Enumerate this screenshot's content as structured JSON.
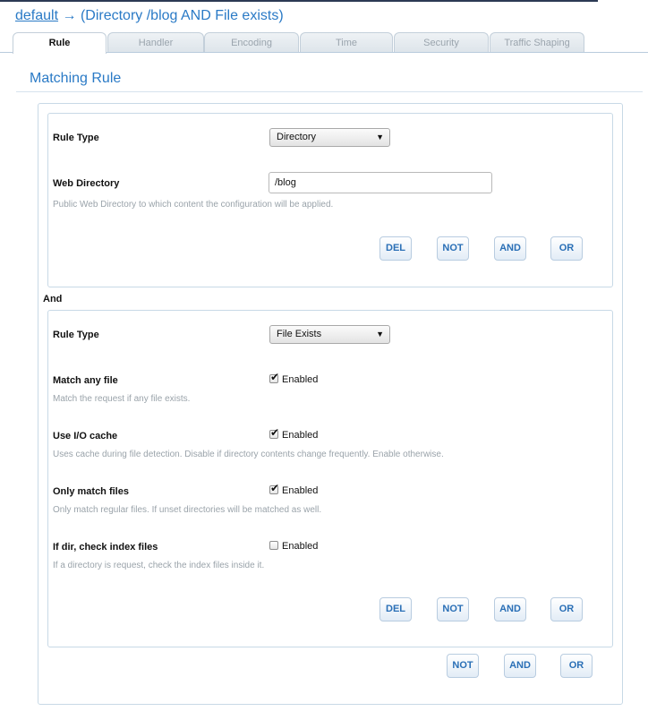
{
  "header": {
    "root_link": "default",
    "crumb_rest": " → (Directory /blog AND File exists)"
  },
  "tabs": [
    {
      "label": "Rule",
      "active": true
    },
    {
      "label": "Handler"
    },
    {
      "label": "Encoding"
    },
    {
      "label": "Time"
    },
    {
      "label": "Security"
    },
    {
      "label": "Traffic Shaping"
    }
  ],
  "section": {
    "title": "Matching Rule"
  },
  "rule1": {
    "type_label": "Rule Type",
    "type_value": "Directory",
    "dir_label": "Web Directory",
    "dir_value": "/blog",
    "dir_hint": "Public Web Directory to which content the configuration will be applied."
  },
  "and_label": "And",
  "rule2": {
    "type_label": "Rule Type",
    "type_value": "File Exists",
    "options": [
      {
        "label": "Match any file",
        "checked": true,
        "check_text": "Enabled",
        "hint": "Match the request if any file exists."
      },
      {
        "label": "Use I/O cache",
        "checked": true,
        "check_text": "Enabled",
        "hint": "Uses cache during file detection. Disable if directory contents change frequently. Enable otherwise."
      },
      {
        "label": "Only match files",
        "checked": true,
        "check_text": "Enabled",
        "hint": "Only match regular files. If unset directories will be matched as well."
      },
      {
        "label": "If dir, check index files",
        "checked": false,
        "check_text": "Enabled",
        "hint": "If a directory is request, check the index files inside it."
      }
    ]
  },
  "buttons": {
    "del": "DEL",
    "not": "NOT",
    "and": "AND",
    "or": "OR"
  },
  "icons": {
    "dropdown": "triangle-down-icon",
    "check": "checkmark-icon"
  },
  "colors": {
    "accent": "#2a7ac6",
    "border": "#c8d9e6",
    "hint": "#9aa3aa"
  }
}
